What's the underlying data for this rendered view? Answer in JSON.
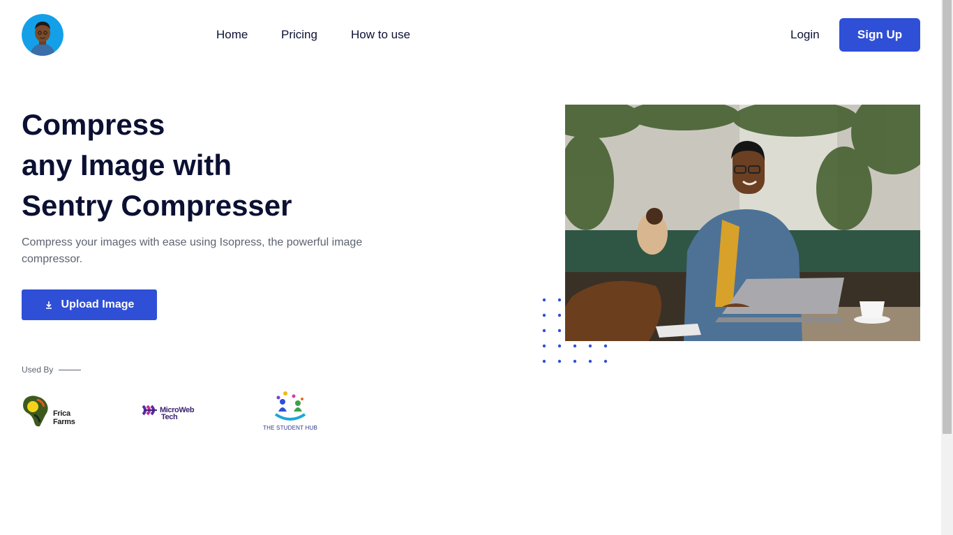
{
  "header": {
    "nav": [
      {
        "label": "Home"
      },
      {
        "label": "Pricing"
      },
      {
        "label": "How to use"
      }
    ],
    "login_label": "Login",
    "signup_label": "Sign Up"
  },
  "hero": {
    "title_lines": [
      "Compress",
      "any Image with",
      "Sentry Compresser"
    ],
    "subtitle": "Compress your images with ease using Isopress, the powerful image compressor.",
    "upload_label": "Upload Image"
  },
  "used_by": {
    "label": "Used By",
    "partners": [
      {
        "line1": "Frica",
        "line2": "Farms"
      },
      {
        "line1": "MicroWeb",
        "line2": "Tech"
      },
      {
        "line1": "THE STUDENT HUB"
      }
    ]
  },
  "colors": {
    "accent": "#2f4fd6",
    "heading": "#0b1033",
    "muted": "#5c6370"
  }
}
